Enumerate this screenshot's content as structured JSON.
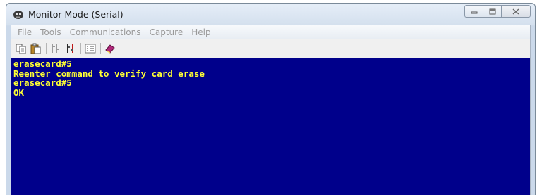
{
  "window": {
    "title": "Monitor Mode (Serial)",
    "app_icon": "robot-icon"
  },
  "caption_buttons": {
    "minimize": "minimize-icon",
    "maximize": "maximize-icon",
    "close": "close-icon"
  },
  "menu": {
    "items": [
      {
        "label": "File"
      },
      {
        "label": "Tools"
      },
      {
        "label": "Communications"
      },
      {
        "label": "Capture"
      },
      {
        "label": "Help"
      }
    ]
  },
  "toolbar": {
    "icons": [
      "copy-icon",
      "paste-icon",
      "connect-icon",
      "disconnect-icon",
      "list-settings-icon",
      "book-icon"
    ]
  },
  "terminal": {
    "background": "#00008b",
    "text_color": "#ffff33",
    "lines": [
      "erasecard#5",
      "Reenter command to verify card erase",
      "erasecard#5",
      "OK"
    ]
  }
}
